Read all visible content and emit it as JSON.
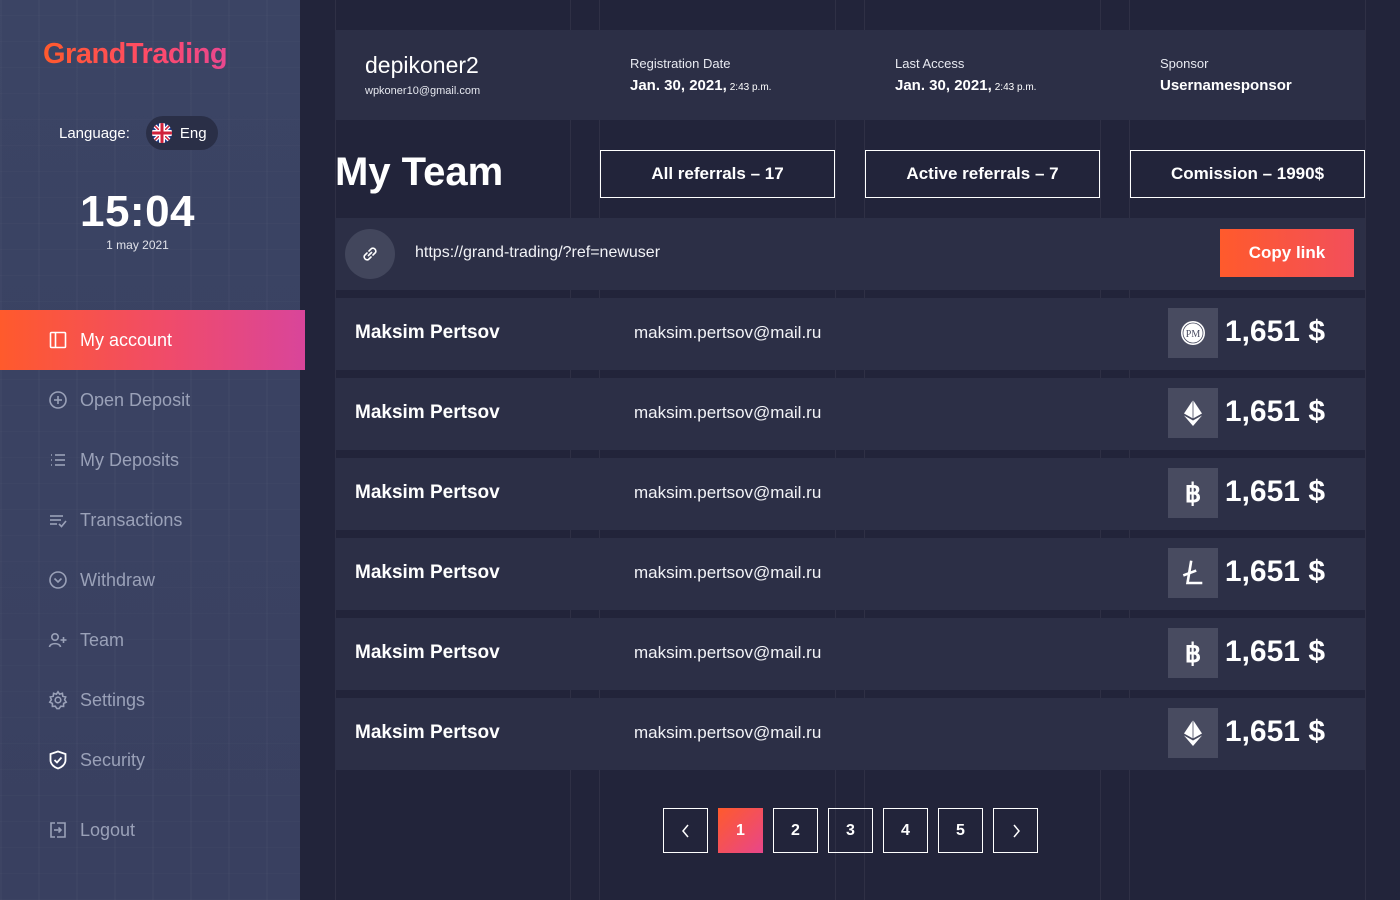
{
  "app": {
    "brand": "GrandTrading"
  },
  "language": {
    "label": "Language:",
    "value": "Eng"
  },
  "clock": {
    "time": "15:04",
    "date": "1 may 2021"
  },
  "nav": {
    "items": [
      {
        "label": "My account",
        "icon": "panel-icon",
        "active": true
      },
      {
        "label": "Open Deposit",
        "icon": "plus-circle-icon"
      },
      {
        "label": "My Deposits",
        "icon": "list-icon"
      },
      {
        "label": "Transactions",
        "icon": "transactions-icon"
      },
      {
        "label": "Withdraw",
        "icon": "chevron-circle-icon"
      },
      {
        "label": "Team",
        "icon": "add-user-icon"
      },
      {
        "label": "Settings",
        "icon": "gear-icon"
      },
      {
        "label": "Security",
        "icon": "shield-icon"
      }
    ],
    "logout": {
      "label": "Logout",
      "icon": "logout-icon"
    }
  },
  "profile": {
    "username": "depikoner2",
    "email": "wpkoner10@gmail.com",
    "registration": {
      "label": "Registration Date",
      "date": "Jan. 30, 2021,",
      "time": "2:43 p.m."
    },
    "last_access": {
      "label": "Last Access",
      "date": "Jan. 30, 2021,",
      "time": "2:43 p.m."
    },
    "sponsor": {
      "label": "Sponsor",
      "value": "Usernamesponsor"
    }
  },
  "page": {
    "title": "My Team"
  },
  "stats": {
    "all_referrals": "All referrals – 17",
    "active_referrals": "Active referrals – 7",
    "commission": "Comission – 1990$"
  },
  "referral": {
    "url": "https://grand-trading/?ref=newuser",
    "copy_label": "Copy link"
  },
  "team": [
    {
      "name": "Maksim Pertsov",
      "email": "maksim.pertsov@mail.ru",
      "coin": "perfect-money-icon",
      "amount": "1,651 $"
    },
    {
      "name": "Maksim Pertsov",
      "email": "maksim.pertsov@mail.ru",
      "coin": "ethereum-icon",
      "amount": "1,651 $"
    },
    {
      "name": "Maksim Pertsov",
      "email": "maksim.pertsov@mail.ru",
      "coin": "bitcoin-icon",
      "amount": "1,651 $"
    },
    {
      "name": "Maksim Pertsov",
      "email": "maksim.pertsov@mail.ru",
      "coin": "litecoin-icon",
      "amount": "1,651 $"
    },
    {
      "name": "Maksim Pertsov",
      "email": "maksim.pertsov@mail.ru",
      "coin": "bitcoin-icon",
      "amount": "1,651 $"
    },
    {
      "name": "Maksim Pertsov",
      "email": "maksim.pertsov@mail.ru",
      "coin": "ethereum-icon",
      "amount": "1,651 $"
    }
  ],
  "pagination": {
    "pages": [
      "1",
      "2",
      "3",
      "4",
      "5"
    ],
    "current": "1"
  },
  "colors": {
    "accent_start": "#ff5a2c",
    "accent_end": "#d9459a",
    "background": "#22243a",
    "card": "#2c2f46",
    "sidebar": "#3a4262"
  }
}
